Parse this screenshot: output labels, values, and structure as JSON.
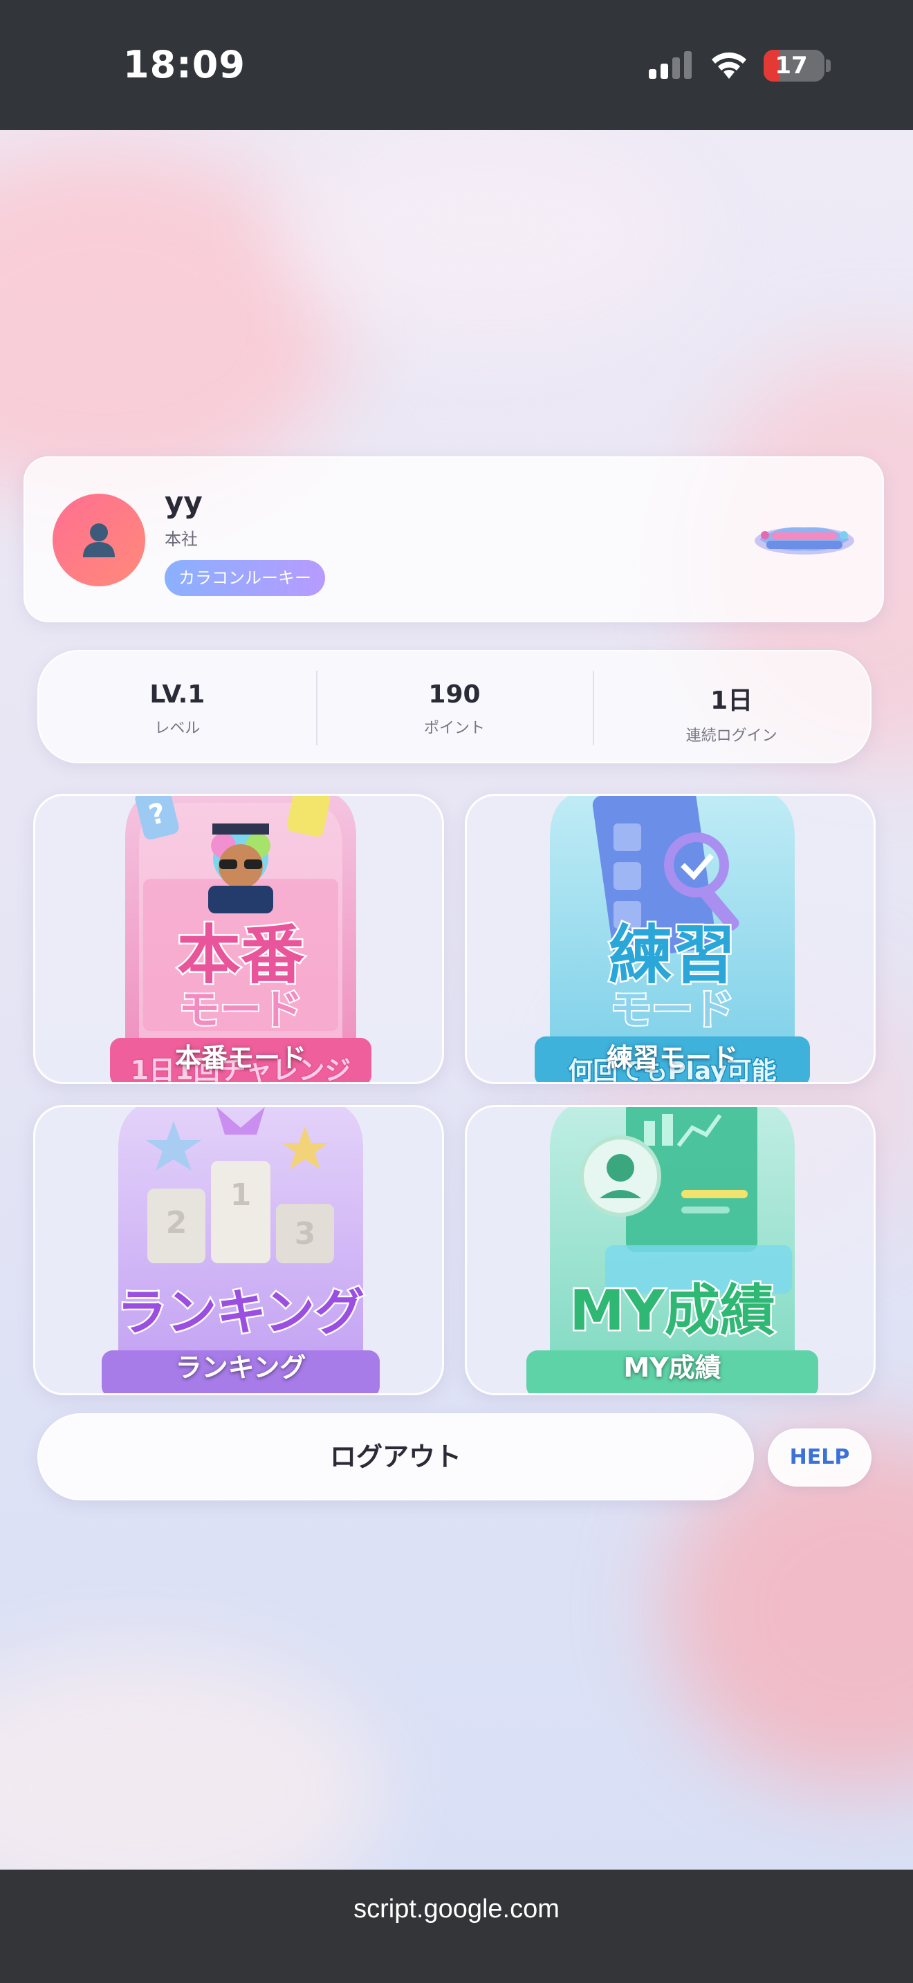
{
  "status_bar": {
    "time": "18:09",
    "battery_level": "17",
    "icons": [
      "signal-icon",
      "wifi-icon",
      "battery-icon"
    ]
  },
  "profile": {
    "name": "yy",
    "branch": "本社",
    "rank_badge": "カラコンルーキー",
    "avatar_icon": "person-icon",
    "colors": {
      "avatar": "#ff6f91",
      "badge_start": "#8ab0ff",
      "badge_end": "#b79bff"
    }
  },
  "stats": [
    {
      "value": "LV.1",
      "label": "レベル"
    },
    {
      "value": "190",
      "label": "ポイント"
    },
    {
      "value": "1日",
      "label": "連続ログイン"
    }
  ],
  "modes": [
    {
      "label": "本番モード",
      "art_title": "本番",
      "art_subtitle": "モード",
      "art_caption": "1日1回チャレンジ",
      "color": "#e8559a"
    },
    {
      "label": "練習モード",
      "art_title": "練習",
      "art_subtitle": "モード",
      "art_caption": "何回でもPlay可能",
      "color": "#2aa7d8"
    },
    {
      "label": "ランキング",
      "art_title": "ランキング",
      "podium": [
        "1",
        "2",
        "3"
      ],
      "color": "#9b4fe0"
    },
    {
      "label": "MY成績",
      "art_title": "MY成績",
      "color": "#2fb874"
    }
  ],
  "actions": {
    "logout_label": "ログアウト",
    "help_label": "HELP"
  },
  "url_bar": {
    "url": "script.google.com"
  }
}
